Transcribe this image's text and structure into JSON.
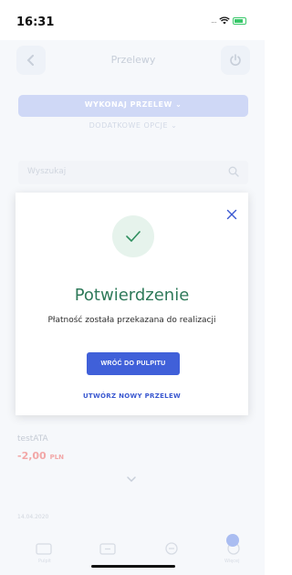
{
  "status_bar": {
    "time": "16:31",
    "signal": "....",
    "battery_color": "#39c86a"
  },
  "header": {
    "title": "Przelewy",
    "back_icon": "chevron-left-icon",
    "power_icon": "power-icon"
  },
  "actions": {
    "primary": "WYKONAJ PRZELEW",
    "secondary": "DODATKOWE OPCJE"
  },
  "search": {
    "placeholder": "Wyszukaj"
  },
  "modal": {
    "title": "Potwierdzenie",
    "message": "Płatność została przekazana do realizacji",
    "primary_button": "WRÓĆ DO PULPITU",
    "secondary_link": "UTWÓRZ NOWY PRZELEW",
    "accent_color": "#2f7a5a",
    "button_color": "#4060d9"
  },
  "transaction": {
    "name": "testATA",
    "amount": "-2,00",
    "currency": "PLN",
    "date": "14.04.2020"
  },
  "tabs": [
    {
      "label": "Pulpit",
      "icon": "wallet-icon"
    },
    {
      "label": "",
      "icon": "transfer-icon"
    },
    {
      "label": "",
      "icon": "more-icon"
    },
    {
      "label": "Więcej",
      "icon": "menu-icon"
    }
  ]
}
